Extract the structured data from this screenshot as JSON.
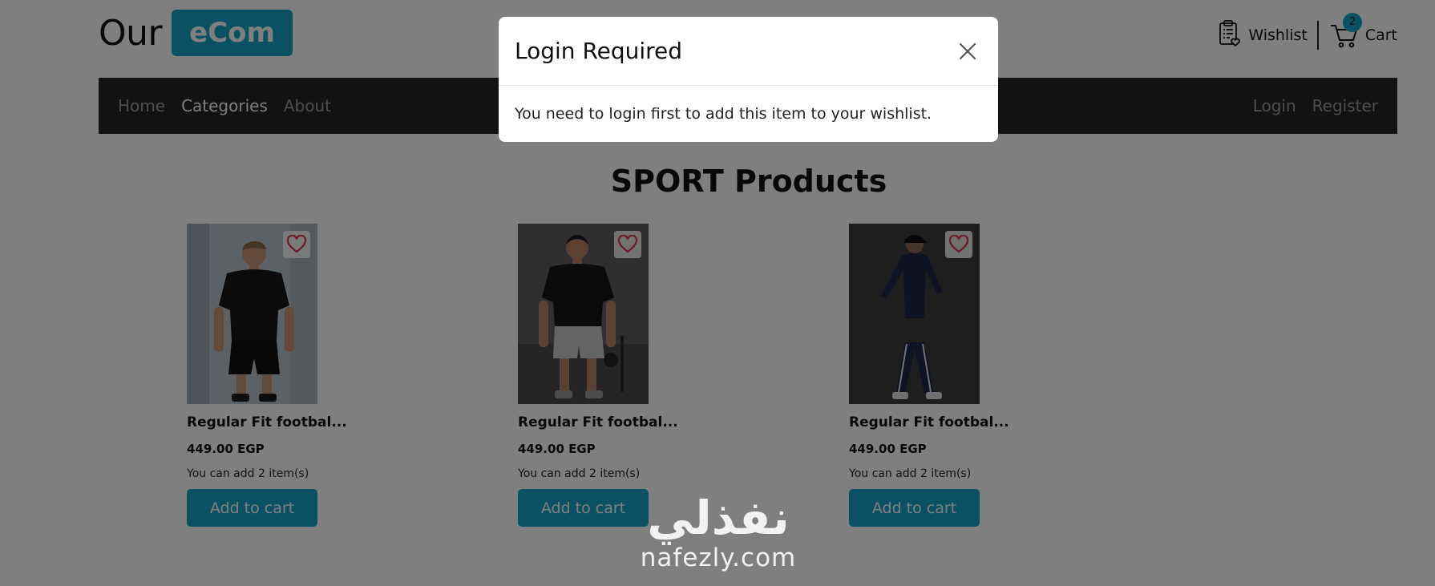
{
  "header": {
    "brand_text": "Our",
    "brand_badge": "eCom",
    "wishlist_label": "Wishlist",
    "cart_label": "Cart",
    "cart_count": "2"
  },
  "nav": {
    "left": [
      {
        "label": "Home"
      },
      {
        "label": "Categories"
      },
      {
        "label": "About"
      }
    ],
    "right": [
      {
        "label": "Login"
      },
      {
        "label": "Register"
      }
    ]
  },
  "page_heading": "SPORT Products",
  "products": [
    {
      "title": "Regular Fit footbal...",
      "price": "449.00 EGP",
      "stock": "You can add 2 item(s)",
      "button": "Add to cart"
    },
    {
      "title": "Regular Fit footbal...",
      "price": "449.00 EGP",
      "stock": "You can add 2 item(s)",
      "button": "Add to cart"
    },
    {
      "title": "Regular Fit footbal...",
      "price": "449.00 EGP",
      "stock": "You can add 2 item(s)",
      "button": "Add to cart"
    }
  ],
  "modal": {
    "title": "Login Required",
    "body": "You need to login first to add this item to your wishlist."
  },
  "watermark": {
    "arabic": "نفذلي",
    "latin": "nafezly.com"
  },
  "colors": {
    "accent": "#17a2c8",
    "navbar": "#212529",
    "heart": "#e0304e"
  }
}
